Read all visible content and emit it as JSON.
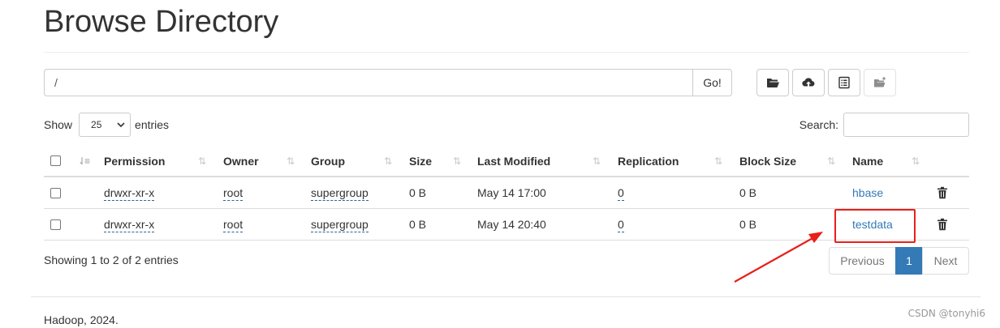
{
  "page": {
    "title": "Browse Directory",
    "footer": "Hadoop, 2024.",
    "watermark": "CSDN @tonyhi6"
  },
  "path_bar": {
    "value": "/",
    "go_label": "Go!"
  },
  "toolbar": {
    "icons": [
      "folder-open-icon",
      "cloud-upload-icon",
      "list-alt-icon",
      "new-folder-icon"
    ],
    "last_disabled": true
  },
  "controls": {
    "show_prefix": "Show",
    "entries_value": "25",
    "show_suffix": "entries",
    "search_label": "Search:"
  },
  "table": {
    "columns": [
      "Permission",
      "Owner",
      "Group",
      "Size",
      "Last Modified",
      "Replication",
      "Block Size",
      "Name"
    ],
    "rows": [
      {
        "permission": "drwxr-xr-x",
        "owner": "root",
        "group": "supergroup",
        "size": "0 B",
        "last_modified": "May 14 17:00",
        "replication": "0",
        "block_size": "0 B",
        "name": "hbase"
      },
      {
        "permission": "drwxr-xr-x",
        "owner": "root",
        "group": "supergroup",
        "size": "0 B",
        "last_modified": "May 14 20:40",
        "replication": "0",
        "block_size": "0 B",
        "name": "testdata"
      }
    ]
  },
  "table_info": "Showing 1 to 2 of 2 entries",
  "pagination": {
    "previous": "Previous",
    "current": "1",
    "next": "Next"
  },
  "annotation": {
    "highlight_color": "#e8201a",
    "highlighted_item": "testdata"
  },
  "colors": {
    "link": "#337ab7",
    "active_page": "#337ab7"
  }
}
